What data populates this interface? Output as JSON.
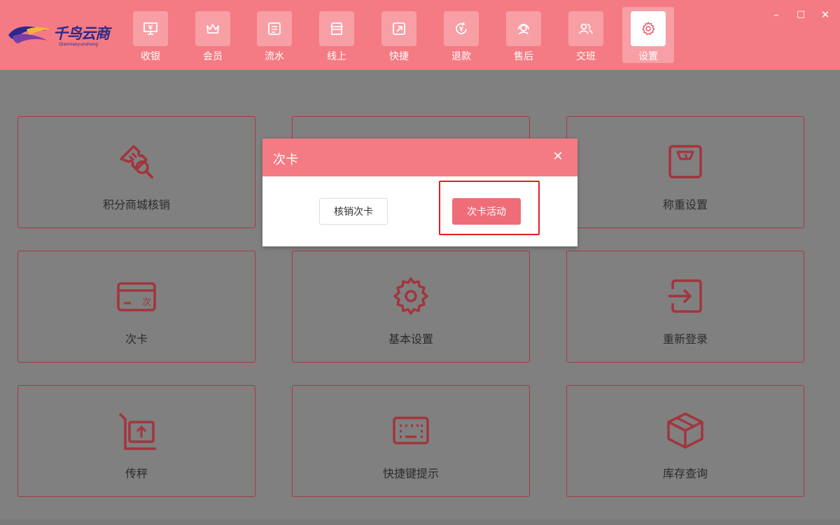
{
  "app": {
    "logo_text": "千鸟云商",
    "logo_sub": "Qianniaoyunshang"
  },
  "nav": {
    "items": [
      {
        "label": "收银",
        "icon": "monitor-yen-icon"
      },
      {
        "label": "会员",
        "icon": "crown-icon"
      },
      {
        "label": "流水",
        "icon": "list-icon"
      },
      {
        "label": "线上",
        "icon": "store-icon"
      },
      {
        "label": "快捷",
        "icon": "quick-arrow-icon"
      },
      {
        "label": "退款",
        "icon": "refund-icon"
      },
      {
        "label": "售后",
        "icon": "headset-icon"
      },
      {
        "label": "交班",
        "icon": "users-icon"
      },
      {
        "label": "设置",
        "icon": "gear-icon"
      }
    ],
    "active_index": 8
  },
  "window_controls": {
    "minimize": "–",
    "maximize": "□",
    "close": "✕"
  },
  "cards": [
    {
      "label": "积分商城核销",
      "icon": "ticket-search-icon"
    },
    {
      "label": "",
      "icon": ""
    },
    {
      "label": "称重设置",
      "icon": "scale-icon"
    },
    {
      "label": "次卡",
      "icon": "card-icon",
      "icon_text": "次"
    },
    {
      "label": "基本设置",
      "icon": "gear-icon"
    },
    {
      "label": "重新登录",
      "icon": "login-icon"
    },
    {
      "label": "传秤",
      "icon": "upload-scale-icon"
    },
    {
      "label": "快捷键提示",
      "icon": "keyboard-icon"
    },
    {
      "label": "库存查询",
      "icon": "box-icon"
    }
  ],
  "modal": {
    "title": "次卡",
    "close": "✕",
    "buttons": {
      "verify": "核销次卡",
      "activity": "次卡活动"
    }
  },
  "colors": {
    "brand": "#f47b83",
    "primary_button": "#ee6d79",
    "icon_dark": "#a3343c",
    "overlay": "#808080",
    "highlight": "#e02020"
  }
}
